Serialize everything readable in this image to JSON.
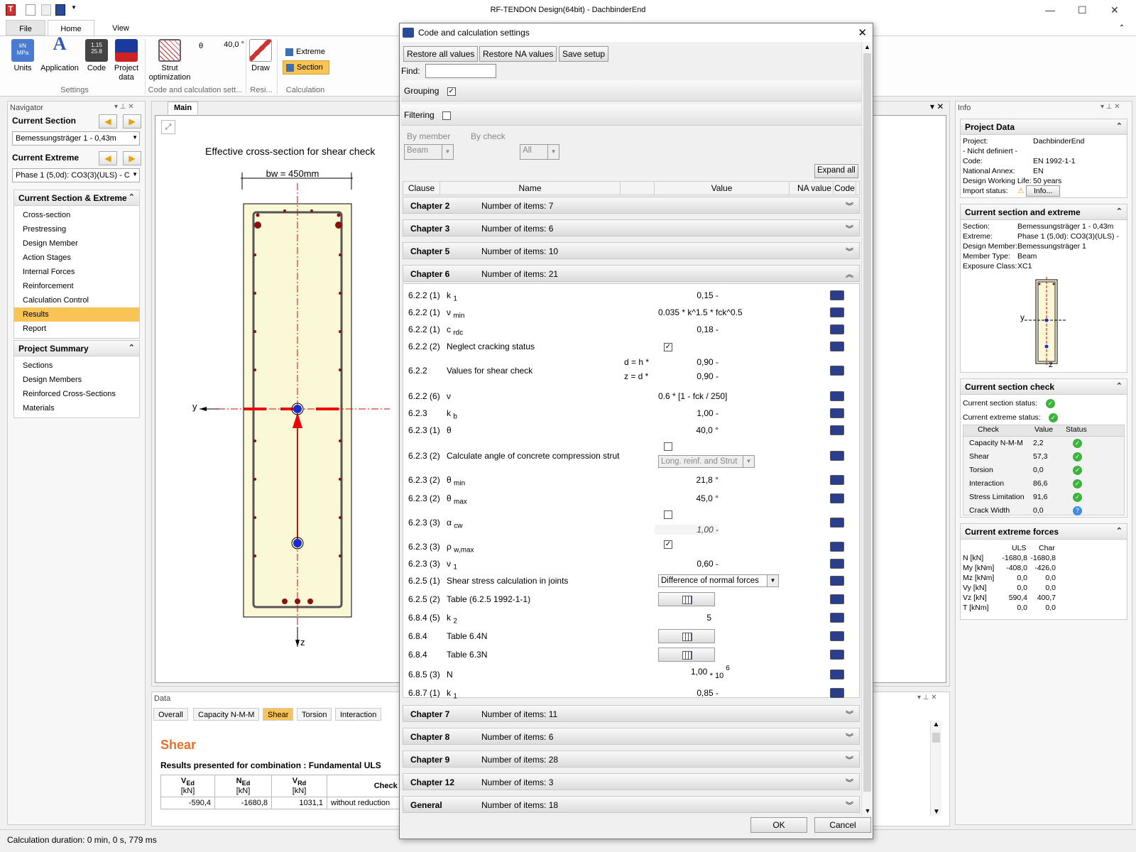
{
  "window": {
    "title": "RF-TENDON Design(64bit) - DachbinderEnd"
  },
  "ribbon": {
    "tabs": [
      "File",
      "Home",
      "View"
    ],
    "buttons": {
      "units": "Units",
      "application": "Application",
      "code": "Code",
      "project_data": "Project data",
      "strut_optimization": "Strut optimization",
      "theta_symbol": "θ",
      "theta_value": "40,0 °",
      "draw": "Draw",
      "extreme": "Extreme",
      "section": "Section"
    },
    "groups": {
      "settings": "Settings",
      "code_calc": "Code and calculation sett...",
      "resi": "Resi...",
      "calculation": "Calculation"
    }
  },
  "navigator": {
    "title": "Navigator",
    "current_section_label": "Current Section",
    "current_section_value": "Bemessungsträger 1 - 0,43m",
    "current_extreme_label": "Current Extreme",
    "current_extreme_value": "Phase 1 (5,0d): CO3(3)(ULS) - C",
    "sec_extreme_header": "Current Section & Extreme",
    "sec_extreme_items": [
      "Cross-section",
      "Prestressing",
      "Design Member",
      "Action Stages",
      "Internal Forces",
      "Reinforcement",
      "Calculation Control",
      "Results",
      "Report"
    ],
    "selected_item": "Results",
    "summary_header": "Project Summary",
    "summary_items": [
      "Sections",
      "Design Members",
      "Reinforced Cross-Sections",
      "Materials"
    ]
  },
  "main": {
    "tab": "Main",
    "drawing_title": "Effective cross-section for shear check",
    "bw_label": "bw = 450mm",
    "y_axis": "y",
    "z_axis": "z"
  },
  "data_panel": {
    "title": "Data",
    "tabs": [
      "Overall",
      "Capacity N-M-M",
      "Shear",
      "Torsion",
      "Interaction"
    ],
    "active_tab": "Shear",
    "heading": "Shear",
    "subtitle": "Results presented for combination : Fundamental ULS",
    "table": {
      "headers": [
        {
          "main": "V",
          "sub": "Ed",
          "unit": "[kN]"
        },
        {
          "main": "N",
          "sub": "Ed",
          "unit": "[kN]"
        },
        {
          "main": "V",
          "sub": "Rd",
          "unit": "[kN]"
        },
        {
          "main": "Check zo",
          "sub": "",
          "unit": ""
        }
      ],
      "row": [
        "-590,4",
        "-1680,8",
        "1031,1",
        "without reduction"
      ]
    }
  },
  "info_panel": {
    "title": "Info",
    "project_data": {
      "header": "Project Data",
      "rows": [
        [
          "Project:",
          "DachbinderEnd"
        ],
        [
          "- Nicht definiert -",
          ""
        ],
        [
          "Code:",
          "EN 1992-1-1"
        ],
        [
          "National Annex:",
          "EN"
        ],
        [
          "Design Working Life:",
          "50 years"
        ],
        [
          "Import status:",
          ""
        ]
      ],
      "info_button": "Info..."
    },
    "current_section": {
      "header": "Current section and extreme",
      "rows": [
        [
          "Section:",
          "Bemessungsträger 1 - 0,43m"
        ],
        [
          "Extreme:",
          "Phase 1 (5,0d): CO3(3)(ULS) -"
        ],
        [
          "Design Member:",
          "Bemessungsträger 1"
        ],
        [
          "Member Type:",
          "Beam"
        ],
        [
          "Exposure Class:",
          "XC1"
        ]
      ],
      "y": "y",
      "z": "z"
    },
    "section_check": {
      "header": "Current section check",
      "section_status": "Current section status:",
      "extreme_status": "Current extreme status:",
      "cols": [
        "Check",
        "Value",
        "Status"
      ],
      "rows": [
        [
          "Capacity N-M-M",
          "2,2",
          "ok"
        ],
        [
          "Shear",
          "57,3",
          "ok"
        ],
        [
          "Torsion",
          "0,0",
          "ok"
        ],
        [
          "Interaction",
          "86,6",
          "ok"
        ],
        [
          "Stress Limitation",
          "91,6",
          "ok"
        ],
        [
          "Crack Width",
          "0,0",
          "info"
        ]
      ]
    },
    "extreme_forces": {
      "header": "Current extreme forces",
      "cols": [
        "ULS",
        "Char"
      ],
      "rows": [
        [
          "N [kN]",
          "-1680,8",
          "-1680,8"
        ],
        [
          "My [kNm]",
          "-408,0",
          "-426,0"
        ],
        [
          "Mz [kNm]",
          "0,0",
          "0,0"
        ],
        [
          "Vy [kN]",
          "0,0",
          "0,0"
        ],
        [
          "Vz [kN]",
          "590,4",
          "400,7"
        ],
        [
          "T [kNm]",
          "0,0",
          "0,0"
        ]
      ]
    }
  },
  "status_bar": {
    "text": "Calculation duration: 0 min, 0 s, 779 ms"
  },
  "dialog": {
    "title": "Code and calculation settings",
    "buttons": {
      "restore_all": "Restore all values",
      "restore_na": "Restore NA values",
      "save_setup": "Save setup",
      "expand_all": "Expand all",
      "ok": "OK",
      "cancel": "Cancel"
    },
    "find_label": "Find:",
    "find_value": "",
    "grouping_label": "Grouping",
    "filtering_label": "Filtering",
    "by_member_label": "By member",
    "by_member_value": "Beam",
    "by_check_label": "By check",
    "by_check_value": "All",
    "columns": [
      "Clause",
      "Name",
      "Value",
      "NA value",
      "Code"
    ],
    "chapters_top": [
      {
        "name": "Chapter 2",
        "items": "Number of items: 7"
      },
      {
        "name": "Chapter 3",
        "items": "Number of items: 6"
      },
      {
        "name": "Chapter 5",
        "items": "Number of items: 10"
      },
      {
        "name": "Chapter 6",
        "items": "Number of items: 21"
      }
    ],
    "chapters_bottom": [
      {
        "name": "Chapter 7",
        "items": "Number of items: 11"
      },
      {
        "name": "Chapter 8",
        "items": "Number of items: 6"
      },
      {
        "name": "Chapter 9",
        "items": "Number of items: 28"
      },
      {
        "name": "Chapter 12",
        "items": "Number of items: 3"
      },
      {
        "name": "General",
        "items": "Number of items: 18"
      }
    ],
    "ch6": {
      "r1": {
        "clause": "6.2.2 (1)",
        "name": "k",
        "sub": "1",
        "value": "0,15 -"
      },
      "r2": {
        "clause": "6.2.2 (1)",
        "name": "ν",
        "sub": "min",
        "value": "0.035 * k^1.5 * fck^0.5"
      },
      "r3": {
        "clause": "6.2.2 (1)",
        "name": "c",
        "sub": "rdc",
        "value": "0,18 -"
      },
      "r4": {
        "clause": "6.2.2 (2)",
        "name": "Neglect cracking status"
      },
      "r5": {
        "clause": "6.2.2",
        "name": "Values for shear check",
        "d_label": "d = h *",
        "d_value": "0,90 -",
        "z_label": "z = d *",
        "z_value": "0,90 -"
      },
      "r6": {
        "clause": "6.2.2 (6)",
        "name": "ν",
        "value": "0.6 * [1 - fck / 250]"
      },
      "r7": {
        "clause": "6.2.3",
        "name": "k",
        "sub": "b",
        "value": "1,00 -"
      },
      "r8": {
        "clause": "6.2.3 (1)",
        "name": "θ",
        "value": "40,0 °"
      },
      "r9": {
        "clause": "6.2.3 (2)",
        "name": "Calculate angle of concrete compression strut",
        "dropdown": "Long. reinf. and Strut"
      },
      "r10": {
        "clause": "6.2.3 (2)",
        "name": "θ",
        "sub": "min",
        "value": "21,8 °"
      },
      "r11": {
        "clause": "6.2.3 (2)",
        "name": "θ",
        "sub": "max",
        "value": "45,0 °"
      },
      "r12": {
        "clause": "6.2.3 (3)",
        "name": "α",
        "sub": "cw",
        "value": "1,00 -"
      },
      "r13": {
        "clause": "6.2.3 (3)",
        "name": "ρ",
        "sub": "w,max"
      },
      "r14": {
        "clause": "6.2.3 (3)",
        "name": "ν",
        "sub": "1",
        "value": "0,60 -"
      },
      "r15": {
        "clause": "6.2.5 (1)",
        "name": "Shear stress calculation in joints",
        "dropdown": "Difference of normal forces"
      },
      "r16": {
        "clause": "6.2.5 (2)",
        "name": "Table (6.2.5 1992-1-1)"
      },
      "r17": {
        "clause": "6.8.4 (5)",
        "name": "k",
        "sub": "2",
        "value": "5"
      },
      "r18": {
        "clause": "6.8.4",
        "name": "Table 6.4N"
      },
      "r19": {
        "clause": "6.8.4",
        "name": "Table 6.3N"
      },
      "r20": {
        "clause": "6.8.5 (3)",
        "name": "N",
        "value": "1,00",
        "mult": "* 10",
        "exp": "6"
      },
      "r21": {
        "clause": "6.8.7 (1)",
        "name": "k",
        "sub": "1",
        "value": "0,85 -"
      }
    }
  }
}
